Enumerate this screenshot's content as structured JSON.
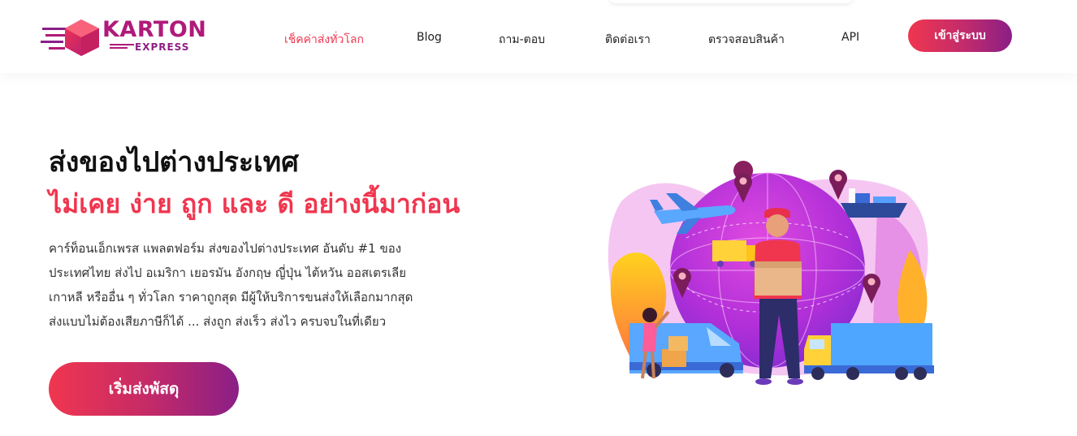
{
  "brand": {
    "name_main": "KARTON",
    "name_sub": "EXPRESS",
    "colors": {
      "primary": "#f0364f",
      "secondary": "#8a1f86"
    }
  },
  "nav": {
    "items": [
      {
        "label": "เช็คค่าส่งทั่วโลก",
        "active": true
      },
      {
        "label": "Blog",
        "active": false
      },
      {
        "label": "ถาม-ตอบ",
        "active": false
      },
      {
        "label": "ติดต่อเรา",
        "active": false
      },
      {
        "label": "ตรวจสอบสินค้า",
        "active": false
      },
      {
        "label": "API",
        "active": false
      }
    ],
    "login_label": "เข้าสู่ระบบ"
  },
  "hero": {
    "title": "ส่งของไปต่างประเทศ",
    "subtitle": "ไม่เคย ง่าย ถูก และ ดี อย่างนี้มาก่อน",
    "description_lines": [
      "คาร์ท็อนเอ็กเพรส แพลตฟอร์ม ส่งของไปต่างประเทศ อันดับ #1 ของ",
      "ประเทศไทย ส่งไป อเมริกา เยอรมัน อังกฤษ ญี่ปุ่น ไต้หวัน ออสเตรเลีย",
      "เกาหลี หรืออื่น ๆ ทั่วโลก ราคาถูกสุด มีผู้ให้บริการขนส่งให้เลือกมากสุด",
      "ส่งแบบไม่ต้องเสียภาษีก็ได้ ... ส่งถูก ส่งเร็ว ส่งไว ครบจบในที่เดียว"
    ],
    "cta_label": "เริ่มส่งพัสดุ"
  },
  "illustration": {
    "subject": "delivery-man-globe-logistics",
    "icons": [
      "airplane-icon",
      "cargo-ship-icon",
      "truck-icon",
      "van-icon",
      "location-pin-icon",
      "package-icon"
    ]
  }
}
